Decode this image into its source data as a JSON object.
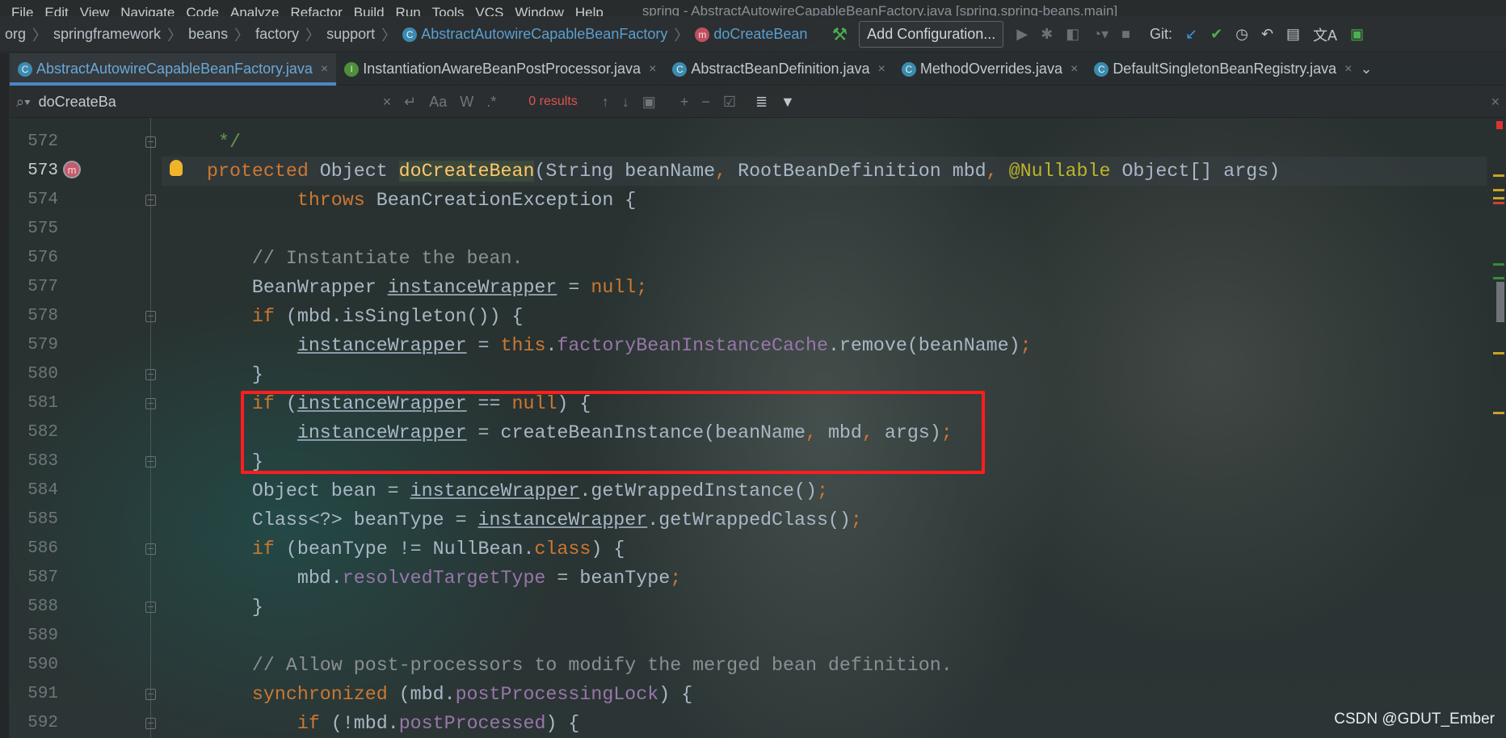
{
  "menubar": {
    "items": [
      "File",
      "Edit",
      "View",
      "Navigate",
      "Code",
      "Analyze",
      "Refactor",
      "Build",
      "Run",
      "Tools",
      "VCS",
      "Window",
      "Help"
    ],
    "title": "spring - AbstractAutowireCapableBeanFactory.java [spring.spring-beans.main]"
  },
  "breadcrumbs": [
    "org",
    "springframework",
    "beans",
    "factory",
    "support"
  ],
  "breadcrumb_class": "AbstractAutowireCapableBeanFactory",
  "breadcrumb_method": "doCreateBean",
  "toolbar": {
    "add_configuration": "Add Configuration...",
    "git_label": "Git:"
  },
  "tabs": [
    {
      "label": "AbstractAutowireCapableBeanFactory.java",
      "icon": "C",
      "active": true
    },
    {
      "label": "InstantiationAwareBeanPostProcessor.java",
      "icon": "I",
      "active": false
    },
    {
      "label": "AbstractBeanDefinition.java",
      "icon": "C",
      "active": false
    },
    {
      "label": "MethodOverrides.java",
      "icon": "C",
      "active": false
    },
    {
      "label": "DefaultSingletonBeanRegistry.java",
      "icon": "C",
      "active": false
    }
  ],
  "search": {
    "value": "doCreateBa",
    "match_case": "Aa",
    "words": "W",
    "regex": ".*",
    "results": "0 results"
  },
  "colors": {
    "keyword": "#cc7832",
    "text": "#a9b7c6",
    "comment": "#808080",
    "field": "#9876aa",
    "annotation": "#bbb529",
    "method": "#ffc66d",
    "highlight_box": "#ff1d1d"
  },
  "code": [
    {
      "n": "572",
      "t": [
        [
          " */",
          "doc"
        ]
      ],
      "fold": true
    },
    {
      "n": "573",
      "t": [
        [
          "protected",
          "kw"
        ],
        [
          " Object ",
          ""
        ],
        [
          "doCreateBean",
          "fn"
        ],
        [
          "(String beanName",
          ""
        ],
        [
          ",",
          "kw"
        ],
        [
          " RootBeanDefinition mbd",
          ""
        ],
        [
          ",",
          "kw"
        ],
        [
          " ",
          ""
        ],
        [
          "@Nullable",
          "ann"
        ],
        [
          " Object[] args)",
          ""
        ]
      ]
    },
    {
      "n": "574",
      "t": [
        [
          "        ",
          ""
        ],
        [
          "throws",
          "kw"
        ],
        [
          " BeanCreationException {",
          ""
        ]
      ],
      "fold": true
    },
    {
      "n": "575",
      "t": []
    },
    {
      "n": "576",
      "t": [
        [
          "    // Instantiate the bean.",
          "cm"
        ]
      ]
    },
    {
      "n": "577",
      "t": [
        [
          "    BeanWrapper ",
          ""
        ],
        [
          "instanceWrapper",
          "ul"
        ],
        [
          " = ",
          ""
        ],
        [
          "null",
          "kw"
        ],
        [
          ";",
          "kw"
        ]
      ]
    },
    {
      "n": "578",
      "t": [
        [
          "    ",
          ""
        ],
        [
          "if",
          "kw"
        ],
        [
          " (mbd.isSingleton()) {",
          ""
        ]
      ],
      "fold": true
    },
    {
      "n": "579",
      "t": [
        [
          "        ",
          ""
        ],
        [
          "instanceWrapper",
          "ul"
        ],
        [
          " = ",
          ""
        ],
        [
          "this",
          "kw"
        ],
        [
          ".",
          ""
        ],
        [
          "factoryBeanInstanceCache",
          "fld"
        ],
        [
          ".remove(beanName)",
          ""
        ],
        [
          ";",
          "kw"
        ]
      ]
    },
    {
      "n": "580",
      "t": [
        [
          "    }",
          ""
        ]
      ],
      "fold": true
    },
    {
      "n": "581",
      "t": [
        [
          "    ",
          ""
        ],
        [
          "if",
          "kw"
        ],
        [
          " (",
          ""
        ],
        [
          "instanceWrapper",
          "ul"
        ],
        [
          " == ",
          ""
        ],
        [
          "null",
          "kw"
        ],
        [
          ") {",
          ""
        ]
      ],
      "fold": true
    },
    {
      "n": "582",
      "t": [
        [
          "        ",
          ""
        ],
        [
          "instanceWrapper",
          "ul"
        ],
        [
          " = createBeanInstance(beanName",
          ""
        ],
        [
          ",",
          "kw"
        ],
        [
          " mbd",
          ""
        ],
        [
          ",",
          "kw"
        ],
        [
          " args)",
          ""
        ],
        [
          ";",
          "kw"
        ]
      ]
    },
    {
      "n": "583",
      "t": [
        [
          "    }",
          ""
        ]
      ],
      "fold": true
    },
    {
      "n": "584",
      "t": [
        [
          "    Object bean = ",
          ""
        ],
        [
          "instanceWrapper",
          "ul"
        ],
        [
          ".getWrappedInstance()",
          ""
        ],
        [
          ";",
          "kw"
        ]
      ]
    },
    {
      "n": "585",
      "t": [
        [
          "    Class<?> beanType = ",
          ""
        ],
        [
          "instanceWrapper",
          "ul"
        ],
        [
          ".getWrappedClass()",
          ""
        ],
        [
          ";",
          "kw"
        ]
      ]
    },
    {
      "n": "586",
      "t": [
        [
          "    ",
          ""
        ],
        [
          "if",
          "kw"
        ],
        [
          " (beanType != NullBean.",
          ""
        ],
        [
          "class",
          "kw"
        ],
        [
          ") {",
          ""
        ]
      ],
      "fold": true
    },
    {
      "n": "587",
      "t": [
        [
          "        mbd.",
          ""
        ],
        [
          "resolvedTargetType",
          "fld"
        ],
        [
          " = beanType",
          ""
        ],
        [
          ";",
          "kw"
        ]
      ]
    },
    {
      "n": "588",
      "t": [
        [
          "    }",
          ""
        ]
      ],
      "fold": true
    },
    {
      "n": "589",
      "t": []
    },
    {
      "n": "590",
      "t": [
        [
          "    // Allow post-processors to modify the merged bean definition.",
          "cm"
        ]
      ]
    },
    {
      "n": "591",
      "t": [
        [
          "    ",
          ""
        ],
        [
          "synchronized",
          "kw"
        ],
        [
          " (mbd.",
          ""
        ],
        [
          "postProcessingLock",
          "fld"
        ],
        [
          ") {",
          ""
        ]
      ],
      "fold": true
    },
    {
      "n": "592",
      "t": [
        [
          "        ",
          ""
        ],
        [
          "if",
          "kw"
        ],
        [
          " (!mbd.",
          ""
        ],
        [
          "postProcessed",
          "fld"
        ],
        [
          ") {",
          ""
        ]
      ],
      "fold": true
    }
  ],
  "current_line": "573",
  "watermark": "CSDN @GDUT_Ember"
}
